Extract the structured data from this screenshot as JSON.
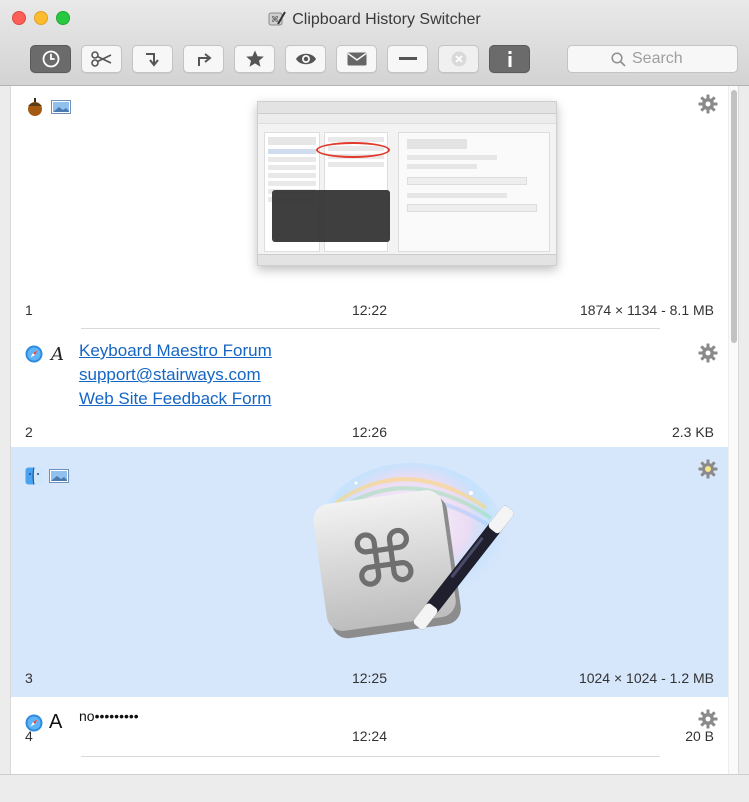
{
  "window": {
    "title": "Clipboard History Switcher"
  },
  "toolbar": {
    "buttons": [
      {
        "icon": "clock-icon",
        "active": true
      },
      {
        "icon": "scissors-icon"
      },
      {
        "icon": "paste-arrow-icon"
      },
      {
        "icon": "redo-arrow-icon"
      },
      {
        "icon": "star-icon"
      },
      {
        "icon": "eye-icon"
      },
      {
        "icon": "envelope-icon"
      },
      {
        "icon": "minus-icon"
      },
      {
        "icon": "close-x-icon",
        "disabled": true
      },
      {
        "icon": "info-icon"
      }
    ],
    "search_placeholder": "Search"
  },
  "items": [
    {
      "index": "1",
      "time": "12:22",
      "info": "1874 × 1134 - 8.1 MB",
      "source_icon": "acorn-icon",
      "type_icon": "image-type-icon",
      "kind": "image"
    },
    {
      "index": "2",
      "time": "12:26",
      "info": "2.3 KB",
      "source_icon": "safari-icon",
      "type_icon": "rich-text-icon",
      "kind": "text",
      "lines": [
        "Keyboard Maestro Forum",
        "support@stairways.com",
        "Web Site Feedback Form"
      ]
    },
    {
      "index": "3",
      "time": "12:25",
      "info": "1024 × 1024 - 1.2 MB",
      "source_icon": "finder-icon",
      "type_icon": "image-type-icon",
      "kind": "image",
      "selected": true
    },
    {
      "index": "4",
      "time": "12:24",
      "info": "20 B",
      "source_icon": "safari-icon",
      "type_icon": "plain-text-icon",
      "kind": "text",
      "type_letter": "A",
      "text": "no•••••••••"
    }
  ],
  "colors": {
    "selection": "#d6e6fb",
    "link": "#1566c4"
  }
}
